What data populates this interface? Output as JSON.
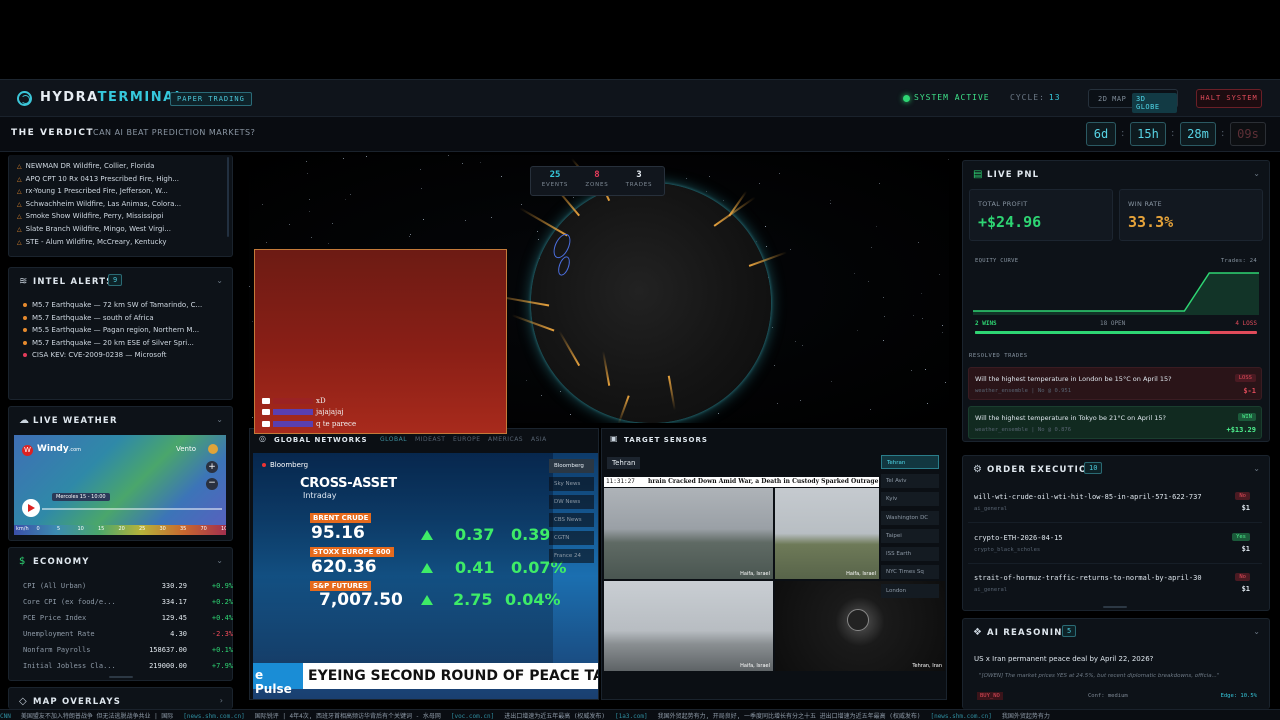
{
  "header": {
    "brand_a": "HYDRA",
    "brand_b": "TERMINAL",
    "mode": "PAPER TRADING",
    "status": "SYSTEM ACTIVE",
    "cycle_label": "CYCLE:",
    "cycle_value": "13",
    "view_2d": "2D MAP",
    "view_3d": "3D GLOBE",
    "halt": "HALT SYSTEM"
  },
  "verdict": {
    "title": "THE VERDICT",
    "subtitle": "CAN AI BEAT PREDICTION MARKETS?",
    "countdown": [
      "6d",
      "15h",
      "28m",
      "09s"
    ]
  },
  "fires": [
    "NEWMAN DR Wildfire, Collier, Florida",
    "APQ CPT 10 Rx 0413 Prescribed Fire, High...",
    "rx-Young 1 Prescribed Fire, Jefferson, W...",
    "Schwachheim Wildfire, Las Animas, Colora...",
    "Smoke Show Wildfire, Perry, Mississippi",
    "Slate Branch Wildfire, Mingo, West Virgi...",
    "STE - Alum Wildfire, McCreary, Kentucky"
  ],
  "intel": {
    "title": "INTEL ALERTS",
    "count": "9",
    "items": [
      {
        "text": "M5.7 Earthquake — 72 km SW of Tamarindo, C...",
        "color": "#e68a2e"
      },
      {
        "text": "M5.7 Earthquake — south of Africa",
        "color": "#e68a2e"
      },
      {
        "text": "M5.5 Earthquake — Pagan region, Northern M...",
        "color": "#e68a2e"
      },
      {
        "text": "M5.7 Earthquake — 20 km ESE of Silver Spri...",
        "color": "#e68a2e"
      },
      {
        "text": "CISA KEV: CVE-2009-0238 — Microsoft",
        "color": "#e23b5a"
      }
    ]
  },
  "weather": {
    "title": "LIVE WEATHER",
    "brand": "Windy",
    "brand_suffix": ".com",
    "mode": "Vento",
    "time": "Mercoles 15 - 10:00",
    "scale": [
      "km/h",
      "0",
      "5",
      "10",
      "15",
      "20",
      "25",
      "30",
      "35",
      "70",
      "100"
    ]
  },
  "economy": {
    "title": "ECONOMY",
    "rows": [
      {
        "l": "CPI (All Urban)",
        "v": "330.29",
        "c": "+0.9%"
      },
      {
        "l": "Core CPI (ex food/e...",
        "v": "334.17",
        "c": "+0.2%"
      },
      {
        "l": "PCE Price Index",
        "v": "129.45",
        "c": "+0.4%"
      },
      {
        "l": "Unemployment Rate",
        "v": "4.30",
        "c": "-2.3%"
      },
      {
        "l": "Nonfarm Payrolls",
        "v": "158637.00",
        "c": "+0.1%"
      },
      {
        "l": "Initial Jobless Cla...",
        "v": "219000.00",
        "c": "+7.9%"
      }
    ]
  },
  "overlays": {
    "title": "MAP OVERLAYS"
  },
  "globe": {
    "events": "25",
    "events_l": "EVENTS",
    "zones": "8",
    "zones_l": "ZONES",
    "trades": "3",
    "trades_l": "TRADES"
  },
  "chat": [
    {
      "msg": "xD"
    },
    {
      "msg": "jajajajaj"
    },
    {
      "msg": "q te parece"
    }
  ],
  "networks": {
    "title": "GLOBAL NETWORKS",
    "tabs": [
      "GLOBAL",
      "MIDEAST",
      "EUROPE",
      "AMERICAS",
      "ASIA"
    ],
    "channels": [
      "Bloomberg",
      "Sky News",
      "DW News",
      "CBS News",
      "CGTN",
      "France 24"
    ],
    "tv": {
      "logo": "Bloomberg",
      "title": "CROSS-ASSET",
      "sub": "Intraday",
      "rows": [
        {
          "name": "BRENT CRUDE",
          "price": "95.16",
          "chg": "0.37",
          "pct": "0.39"
        },
        {
          "name": "STOXX EUROPE 600",
          "price": "620.36",
          "chg": "0.41",
          "pct": "0.07%"
        },
        {
          "name": "S&P FUTURES",
          "price": "7,007.50",
          "chg": "2.75",
          "pct": "0.04%"
        }
      ],
      "pulse": "e Pulse",
      "headline": "EYEING SECOND ROUND OF PEACE TALK"
    }
  },
  "sensors": {
    "title": "TARGET SENSORS",
    "city": "Tehran",
    "time": "11:31:27",
    "banner": "hrain Cracked Down Amid War, a Death in Custody Sparked Outrage",
    "locations": [
      "Tehran",
      "Tel Aviv",
      "Kyiv",
      "Washington DC",
      "Taipei",
      "ISS Earth",
      "NYC Times Sq",
      "London"
    ],
    "cams": [
      "Haifa, Israel",
      "Haifa, Israel",
      "Haifa, Israel",
      "Tehran, Iran"
    ]
  },
  "pnl": {
    "title": "LIVE PNL",
    "profit_l": "TOTAL PROFIT",
    "profit": "+$24.96",
    "win_l": "WIN RATE",
    "win": "33.3%",
    "curve_l": "EQUITY CURVE",
    "trades_l": "Trades: 24",
    "wins": "2 WINS",
    "open": "18 OPEN",
    "losses": "4 LOSS",
    "resolved_l": "RESOLVED TRADES",
    "equity": [
      0,
      0,
      0,
      0,
      0,
      0,
      0,
      0,
      0,
      0,
      0,
      0,
      0,
      0,
      0,
      0,
      0,
      0,
      1,
      2,
      2,
      2,
      2,
      2
    ],
    "resolved": [
      {
        "q": "Will the highest temperature in London be 15°C on April 15?",
        "m": "weather_ensemble | No @ 0.951",
        "r": "LOSS",
        "p": "$-1"
      },
      {
        "q": "Will the highest temperature in Tokyo be 21°C on April 15?",
        "m": "weather_ensemble | No @ 0.876",
        "r": "WIN",
        "p": "+$13.29"
      }
    ]
  },
  "orders": {
    "title": "ORDER EXECUTION",
    "count": "10",
    "items": [
      {
        "q": "will-wti-crude-oil-wti-hit-low-85-in-april-571-622-737",
        "m": "ai_general",
        "s": "No",
        "a": "$1"
      },
      {
        "q": "crypto-ETH-2026-04-15",
        "m": "crypto_black_scholes",
        "s": "Yes",
        "a": "$1"
      },
      {
        "q": "strait-of-hormuz-traffic-returns-to-normal-by-april-30",
        "m": "ai_general",
        "s": "No",
        "a": "$1"
      }
    ]
  },
  "reasoning": {
    "title": "AI REASONING",
    "count": "5",
    "q": "US x Iran permanent peace deal by April 22, 2026?",
    "quote": "\"[OWEN] The market prices YES at 24.5%, but recent diplomatic breakdowns, officia...\"",
    "side": "BUY_NO",
    "conf": "Conf: medium",
    "edge": "Edge: 10.5%"
  },
  "news": [
    {
      "s": "CNN",
      "t": "美国盟友不加入特朗普战争 但无法逃脱战争共业 | 国际"
    },
    {
      "s": "[news.shm.com.cn]",
      "t": "国际锐评 | 4年4次, 西班牙首相高频访华背后有个关键词 - 水母网"
    },
    {
      "s": "[voc.com.cn]",
      "t": "进出口增速为近五年最高 (权威发布)"
    },
    {
      "s": "[1a3.com]",
      "t": "我国外贸起势有力, 开局良好, 一季度同比增长有分之十五 进出口增速为近五年最高 (权威发布)"
    },
    {
      "s": "[news.shm.com.cn]",
      "t": "我国外贸起势有力"
    }
  ]
}
